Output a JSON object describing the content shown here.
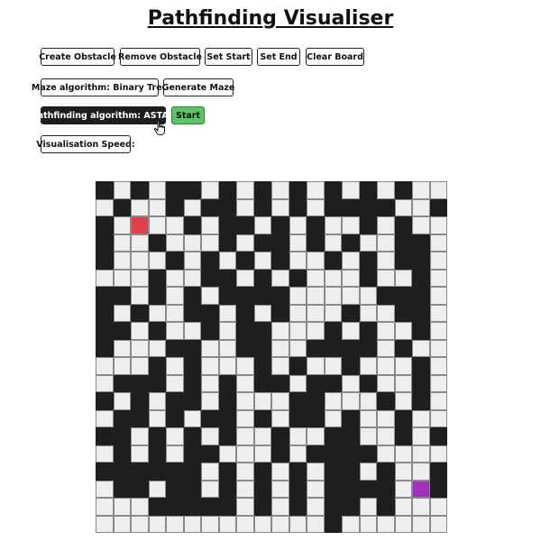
{
  "page": {
    "title": "Pathfinding Visualiser"
  },
  "toolbar": {
    "create_obstacle": "Create Obstacle",
    "remove_obstacle": "Remove Obstacle",
    "set_start": "Set Start",
    "set_end": "Set End",
    "clear_board": "Clear Board",
    "maze_algorithm": "Maze algorithm: Binary Tree",
    "generate_maze": "Generate Maze",
    "pathfinding_algorithm": "Pathfinding algorithm: ASTAR",
    "start": "Start",
    "visualisation_speed": "Visualisation Speed:"
  },
  "colors": {
    "wall": "#1e1e1e",
    "open": "#eeeeee",
    "start_node": "#e0404a",
    "end_node": "#a030c0",
    "start_button": "#5cc46a"
  },
  "icons": {
    "cursor": "hand-pointer-icon"
  },
  "grid": {
    "rows": 20,
    "cols": 20,
    "start": [
      2,
      2
    ],
    "end": [
      18,
      17
    ],
    "cells": [
      "#.#.##.#.#.#.#.#.#..",
      ".#..#.##.#.#.####..#",
      "#.#..#.##.#.#..#.#..",
      "#..#...#.##.#.#..##.",
      "#...#.#.#.#..#.#.##.",
      "...#..##.#.#...#..#.",
      "##.#.#.####.....###.",
      "#.#..##.#.#...#..##.",
      "##.#..#.##...#.#..#.",
      "#...##..##..####.#..",
      "...#.#...#.#..#...#.",
      ".###.#.#.##.##.#..#.",
      "#.#.##.#...##...#.#.",
      ".##.#.##.#.##.#..#..",
      "##.#.#.#..#..##..#.#",
      ".#.#.##...#.####....",
      "######.#.#.#.##.#..#",
      ".##.##.#.#.#.####.##",
      "...#####.#.#.##.#...",
      ".............#......"
    ]
  }
}
